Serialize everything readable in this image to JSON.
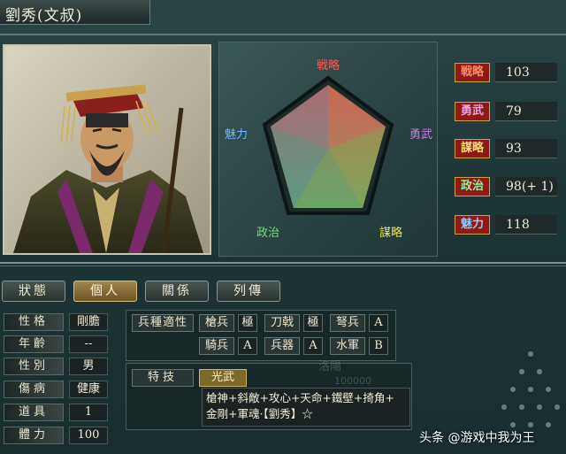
{
  "title": "劉秀(文叔)",
  "radar": {
    "labels": [
      "戦略",
      "勇武",
      "謀略",
      "政治",
      "魅力"
    ],
    "label_colors": [
      "#ff5a5a",
      "#c97fe0",
      "#f2e640",
      "#6fe07a",
      "#6fb8ff"
    ]
  },
  "stats": [
    {
      "label": "戦略",
      "value": "103",
      "color": "#ff6b4a"
    },
    {
      "label": "勇武",
      "value": "79",
      "color": "#e07ad0"
    },
    {
      "label": "謀略",
      "value": "93",
      "color": "#f2df4a"
    },
    {
      "label": "政治",
      "value": "98(+ 1)",
      "color": "#6fe07a"
    },
    {
      "label": "魅力",
      "value": "118",
      "color": "#6fb8ff"
    }
  ],
  "tabs": [
    "狀態",
    "個人",
    "關係",
    "列傳"
  ],
  "active_tab": "個人",
  "info": [
    {
      "label": "性格",
      "value": "剛膽"
    },
    {
      "label": "年齡",
      "value": "--"
    },
    {
      "label": "性別",
      "value": "男"
    },
    {
      "label": "傷病",
      "value": "健康"
    },
    {
      "label": "道具",
      "value": "1"
    },
    {
      "label": "體力",
      "value": "100"
    }
  ],
  "troops": {
    "header": "兵種適性",
    "items": [
      {
        "name": "槍兵",
        "grade": "極"
      },
      {
        "name": "刀戟",
        "grade": "極"
      },
      {
        "name": "弩兵",
        "grade": "A"
      },
      {
        "name": "騎兵",
        "grade": "A"
      },
      {
        "name": "兵器",
        "grade": "A"
      },
      {
        "name": "水軍",
        "grade": "B"
      }
    ]
  },
  "skill": {
    "label": "特技",
    "name": "光武",
    "ghost_text": "洛陽",
    "ghost_number": "100000",
    "list_line1": "槍神+斜敵+攻心+天命+鐵壁+掎角+",
    "list_line2": "金剛+軍魂·【劉秀】☆"
  },
  "watermark": "头条 @游戏中我为王"
}
